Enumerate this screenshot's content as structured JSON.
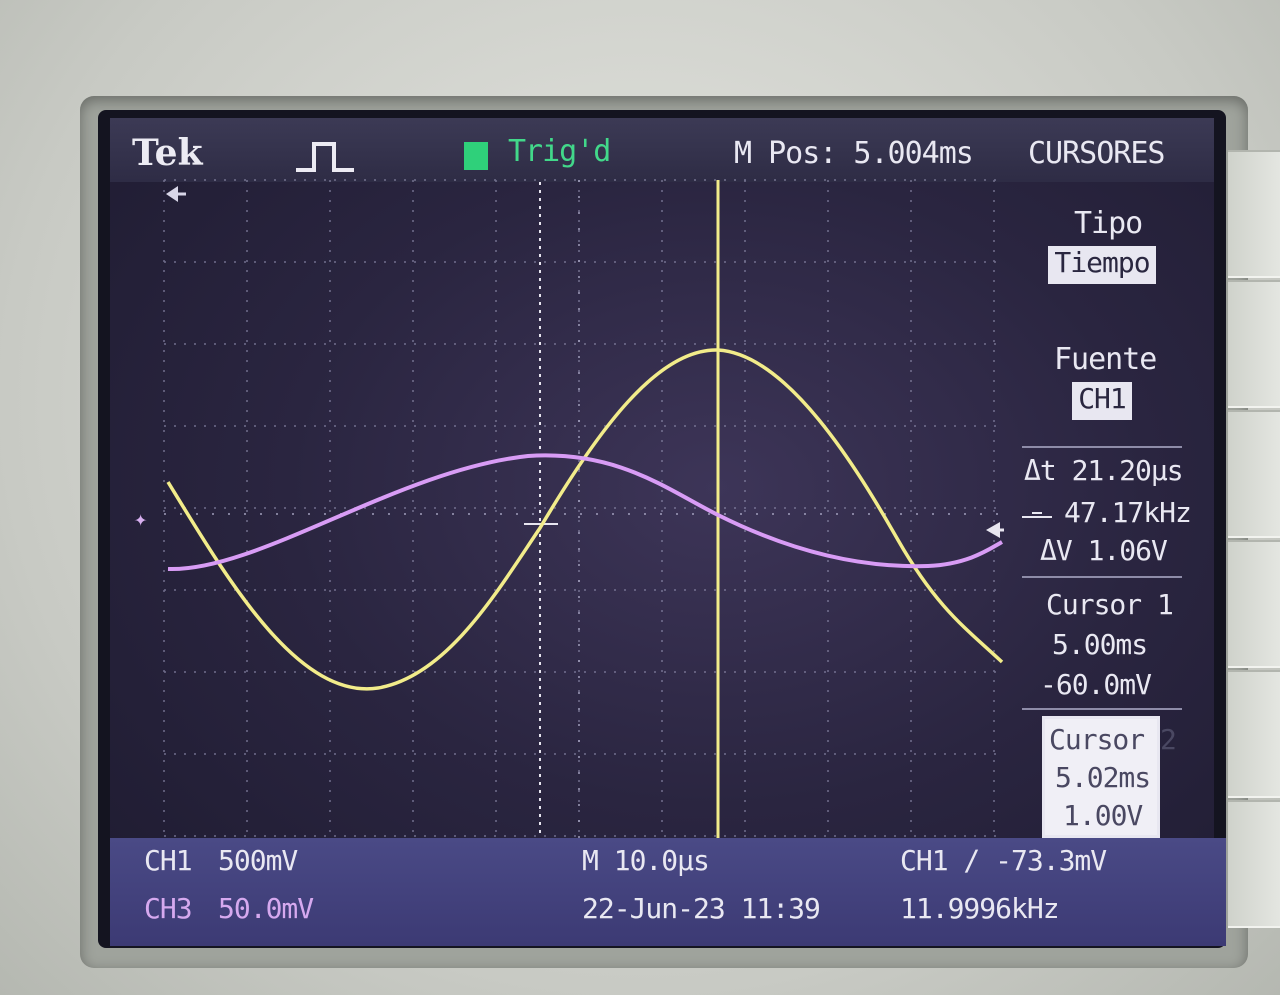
{
  "header": {
    "brand": "Tek",
    "trigger_status": "Trig'd",
    "m_pos": "M Pos: 5.004ms",
    "menu_title": "CURSORES"
  },
  "menu": {
    "tipo_label": "Tipo",
    "tipo_value": "Tiempo",
    "fuente_label": "Fuente",
    "fuente_value": "CH1",
    "delta_t": "Δt 21.20µs",
    "inv_delta_t": "47.17kHz",
    "delta_v": "ΔV 1.06V",
    "cursor1_label": "Cursor 1",
    "cursor1_time": "5.00ms",
    "cursor1_volt": "-60.0mV",
    "cursor2_label": "Cursor 2",
    "cursor2_time": "5.02ms",
    "cursor2_volt": "1.00V"
  },
  "footer": {
    "ch1_label": "CH1",
    "ch1_scale": "500mV",
    "ch3_label": "CH3",
    "ch3_scale": "50.0mV",
    "timebase": "M 10.0µs",
    "datetime": "22-Jun-23 11:39",
    "trigger_info": "CH1 ∕ -73.3mV",
    "frequency": "11.9996kHz"
  },
  "colors": {
    "ch1": "#f2ec8a",
    "ch3": "#d89cf5",
    "trigger_green": "#2fd07a",
    "screen_bg": "#2a2540"
  },
  "icons": {
    "pulse": "pulse-icon",
    "trigger": "trigger-icon",
    "channel_marker": "channel-marker-icon"
  }
}
